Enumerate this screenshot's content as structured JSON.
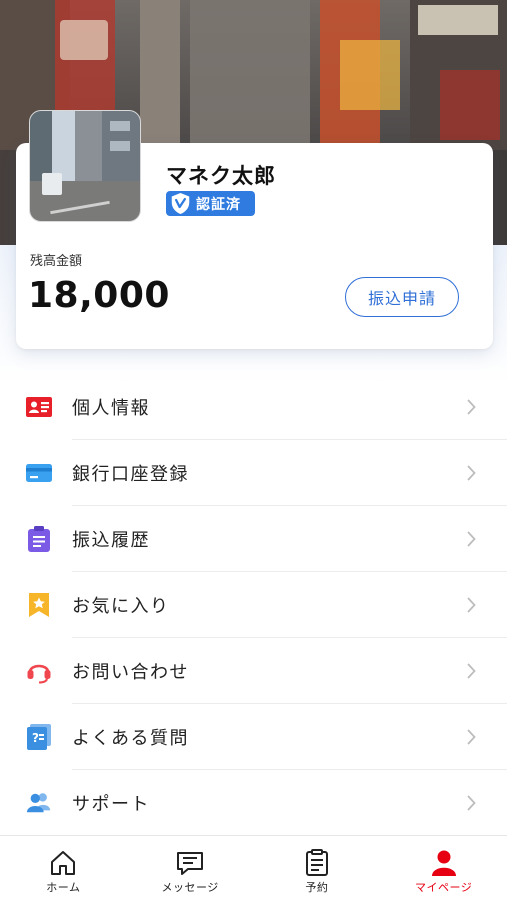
{
  "profile": {
    "name": "マネク太郎",
    "badge": "認証済",
    "balance_label": "残高金額",
    "balance": "18,000",
    "transfer_label": "振込申請"
  },
  "menu": [
    {
      "label": "個人情報",
      "icon": "id-card-icon",
      "color": "#e8202a"
    },
    {
      "label": "銀行口座登録",
      "icon": "bank-card-icon",
      "color": "#3aa0f0"
    },
    {
      "label": "振込履歴",
      "icon": "clipboard-list-icon",
      "color": "#7b5be6"
    },
    {
      "label": "お気に入り",
      "icon": "bookmark-star-icon",
      "color": "#f7b52a"
    },
    {
      "label": "お問い合わせ",
      "icon": "headset-icon",
      "color": "#f0474f"
    },
    {
      "label": "よくある質問",
      "icon": "faq-book-icon",
      "color": "#3a8fe0"
    },
    {
      "label": "サポート",
      "icon": "users-icon",
      "color": "#3a8fe0"
    }
  ],
  "nav": [
    {
      "label": "ホーム",
      "icon": "home-icon",
      "active": false
    },
    {
      "label": "メッセージ",
      "icon": "message-icon",
      "active": false
    },
    {
      "label": "予約",
      "icon": "reservation-icon",
      "active": false
    },
    {
      "label": "マイページ",
      "icon": "user-icon",
      "active": true
    }
  ],
  "colors": {
    "accent": "#2f6fd6",
    "badge": "#2f7be0",
    "active_nav": "#e60012"
  }
}
